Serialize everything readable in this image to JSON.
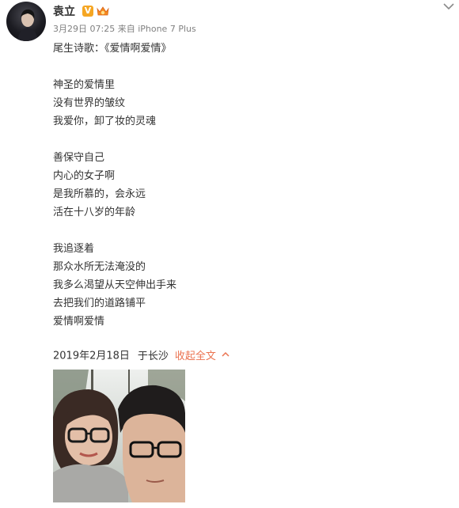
{
  "post": {
    "username": "袁立",
    "verified_badge": "V",
    "timestamp": "3月29日 07:25",
    "source": "来自 iPhone 7 Plus",
    "lines": [
      "尾生诗歌：《爱情啊爱情》",
      "",
      "神圣的爱情里",
      "没有世界的皱纹",
      "我爱你，卸了妆的灵魂",
      "",
      "善保守自己",
      "内心的女子啊",
      "是我所慕的，会永远",
      "活在十八岁的年龄",
      "",
      "我追逐着",
      "那众水所无法淹没的",
      "我多么渴望从天空伸出手来",
      "去把我们的道路铺平",
      "爱情啊爱情"
    ],
    "footer": {
      "date": "2019年2月18日",
      "location": "于长沙",
      "collapse_label": "收起全文"
    },
    "icons": {
      "verified": "verified-badge-icon",
      "level": "crown-level-icon",
      "menu": "chevron-down-icon",
      "collapse": "chevron-up-icon"
    },
    "colors": {
      "accent": "#eb7350",
      "meta": "#808080",
      "text": "#333333",
      "badge": "#f5a623"
    }
  }
}
